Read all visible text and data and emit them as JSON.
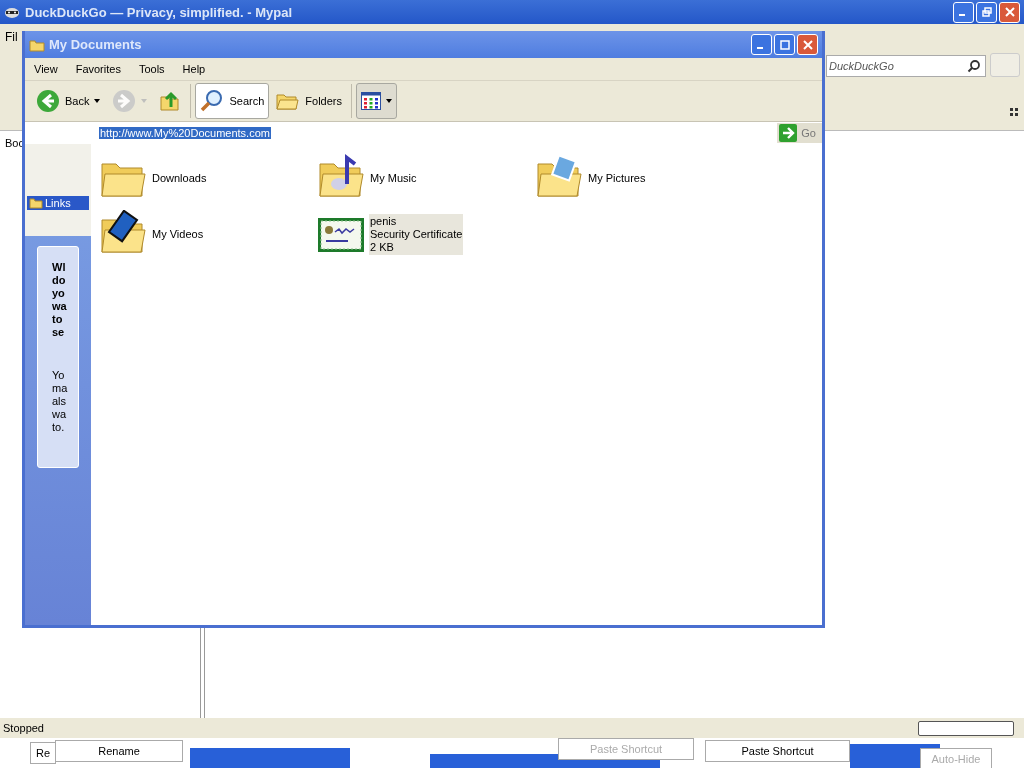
{
  "browser": {
    "title": "DuckDuckGo — Privacy, simplified. - Mypal",
    "menu": [
      "Fil"
    ],
    "search": {
      "placeholder": "DuckDuckGo"
    },
    "bookmarks_label": "Boc",
    "status": "Stopped",
    "progress": {
      "level": 0
    }
  },
  "window": {
    "title": "My Documents",
    "menu": [
      "View",
      "Favorites",
      "Tools",
      "Help"
    ],
    "toolbar": [
      {
        "kind": "back",
        "label": "Back",
        "disabled": false
      },
      {
        "kind": "forward",
        "disabled": true
      },
      {
        "kind": "up",
        "disabled": false
      },
      {
        "kind": "search",
        "label": "Search",
        "selected": true
      },
      {
        "kind": "folders",
        "label": "Folders",
        "selected": false
      },
      {
        "kind": "views",
        "selected": true
      }
    ],
    "address": {
      "value": "http://www.My%20Documents.com",
      "go": "Go"
    },
    "sidebar": {
      "links": {
        "label": "Links",
        "selected": true
      },
      "panel": {
        "heading": "Wl do yo wa to se",
        "body": "Yo ma als wa to."
      }
    },
    "items": [
      {
        "kind": "folder",
        "lines": [
          "Downloads"
        ],
        "selected": false
      },
      {
        "kind": "music",
        "lines": [
          "My Music"
        ],
        "selected": false
      },
      {
        "kind": "pictures",
        "lines": [
          "My Pictures"
        ],
        "selected": false
      },
      {
        "kind": "videos",
        "lines": [
          "My Videos"
        ],
        "selected": false
      },
      {
        "kind": "certificate",
        "lines": [
          "penis",
          "Security Certificate",
          "2 KB"
        ],
        "selected": true
      }
    ]
  },
  "taskbar_fragments": [
    {
      "label": "Re",
      "faded": false
    },
    {
      "label": "Rename",
      "faded": false
    },
    {
      "label": "Paste Shortcut",
      "faded": true
    },
    {
      "label": "Paste Shortcut",
      "faded": false
    },
    {
      "label": "Auto-Hide",
      "faded": true
    }
  ]
}
